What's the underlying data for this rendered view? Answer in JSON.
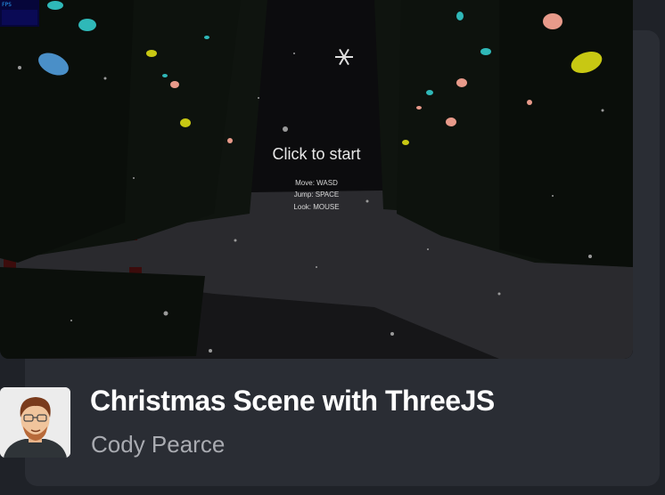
{
  "game": {
    "fps_label": "FPS",
    "prompt": "Click to start",
    "controls": [
      "Move: WASD",
      "Jump: SPACE",
      "Look: MOUSE"
    ]
  },
  "project": {
    "title": "Christmas Scene with ThreeJS",
    "author": "Cody Pearce"
  },
  "colors": {
    "page_bg": "#1f2228",
    "card_bg": "#2a2d34",
    "ornament_teal": "#2fb8b8",
    "ornament_yellow": "#c8c813",
    "ornament_pink": "#e89a8a",
    "ornament_blue": "#4a8fc8",
    "trunk_red": "#5a1010"
  },
  "icons": [
    "snowflake-icon",
    "avatar-portrait"
  ]
}
